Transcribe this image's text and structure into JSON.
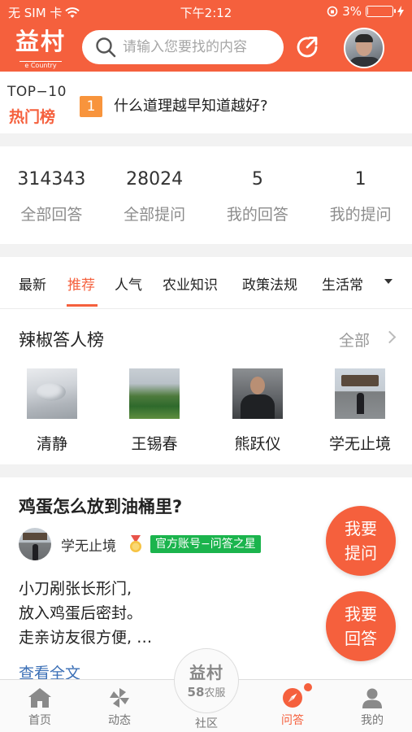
{
  "status_bar": {
    "carrier": "无 SIM 卡",
    "time": "下午2:12",
    "battery_percent": "3%",
    "battery_level": 0.03
  },
  "header": {
    "logo_text": "益村",
    "logo_subtext": "e Country",
    "search_placeholder": "请输入您要找的内容",
    "share_icon": "share-arrow-icon",
    "brand_color": "#f5603d"
  },
  "hot_list": {
    "top_label": "TOP−10",
    "title": "热门榜",
    "rank": "1",
    "question": "什么道理越早知道越好?"
  },
  "stats": [
    {
      "value": "314343",
      "label": "全部回答"
    },
    {
      "value": "28024",
      "label": "全部提问"
    },
    {
      "value": "5",
      "label": "我的回答"
    },
    {
      "value": "1",
      "label": "我的提问"
    }
  ],
  "tabs": [
    {
      "label": "最新",
      "active": false
    },
    {
      "label": "推荐",
      "active": true
    },
    {
      "label": "人气",
      "active": false
    },
    {
      "label": "农业知识",
      "active": false
    },
    {
      "label": "政策法规",
      "active": false
    },
    {
      "label": "生活常",
      "active": false
    }
  ],
  "ranking": {
    "title": "辣椒答人榜",
    "all_label": "全部",
    "people": [
      {
        "name": "清静"
      },
      {
        "name": "王锡春"
      },
      {
        "name": "熊跃仪"
      },
      {
        "name": "学无止境"
      }
    ]
  },
  "question_card": {
    "title": "鸡蛋怎么放到油桶里?",
    "author": "学无止境",
    "badge": "官方账号−问答之星",
    "answer_lines": [
      "小刀剐张长形门,",
      "放入鸡蛋后密封。",
      "走亲访友很方便, …"
    ],
    "read_more": "查看全文"
  },
  "fab": {
    "ask_line1": "我要",
    "ask_line2": "提问",
    "answer_line1": "我要",
    "answer_line2": "回答"
  },
  "bottom_nav": {
    "center_logo": "益村",
    "center_sub_num": "58",
    "center_sub_text": "农服",
    "items": [
      {
        "label": "首页",
        "icon": "home-icon"
      },
      {
        "label": "动态",
        "icon": "pinwheel-icon"
      },
      {
        "label": "社区",
        "icon": "community-icon"
      },
      {
        "label": "问答",
        "icon": "compass-icon",
        "active": true
      },
      {
        "label": "我的",
        "icon": "person-icon"
      }
    ]
  }
}
